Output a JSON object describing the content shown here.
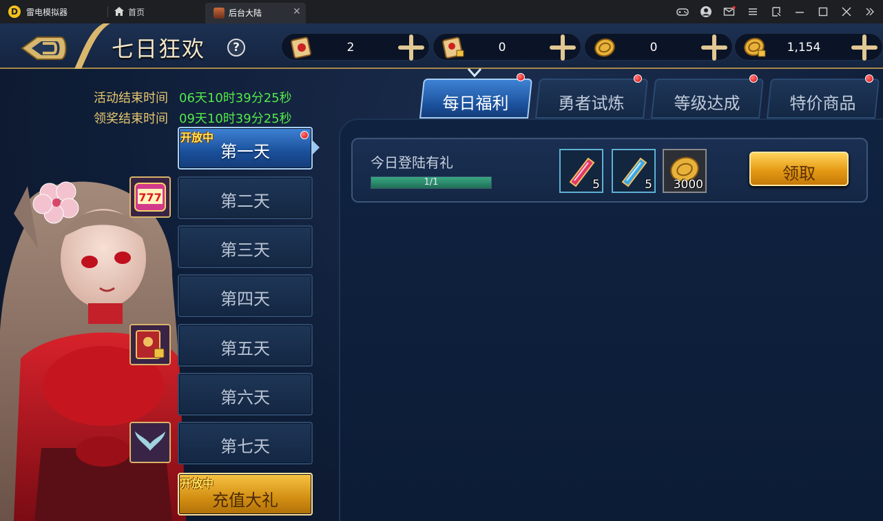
{
  "emulator": {
    "app_name": "雷电模拟器",
    "home_label": "首页",
    "tab_label": "后台大陆",
    "tab_close": "✕",
    "logo_letter": "D"
  },
  "header": {
    "title": "七日狂欢",
    "help": "?",
    "currencies": [
      {
        "icon": "scroll-icon",
        "value": "2"
      },
      {
        "icon": "locked-scroll-icon",
        "value": "0"
      },
      {
        "icon": "gold-coin-icon",
        "value": "0"
      },
      {
        "icon": "locked-coin-icon",
        "value": "1,154"
      }
    ]
  },
  "timers": {
    "activity_label": "活动结束时间",
    "activity_value": "06天10时39分25秒",
    "reward_label": "领奖结束时间",
    "reward_value": "09天10时39分25秒"
  },
  "days": [
    {
      "label": "第一天",
      "state": "active",
      "tag": "开放中"
    },
    {
      "label": "第二天",
      "state": "normal"
    },
    {
      "label": "第三天",
      "state": "normal"
    },
    {
      "label": "第四天",
      "state": "normal"
    },
    {
      "label": "第五天",
      "state": "normal"
    },
    {
      "label": "第六天",
      "state": "normal"
    },
    {
      "label": "第七天",
      "state": "normal"
    },
    {
      "label": "充值大礼",
      "state": "gold",
      "tag": "开放中"
    }
  ],
  "tabs": [
    {
      "label": "每日福利",
      "active": true
    },
    {
      "label": "勇者试炼",
      "active": false
    },
    {
      "label": "等级达成",
      "active": false
    },
    {
      "label": "特价商品",
      "active": false
    }
  ],
  "task": {
    "title": "今日登陆有礼",
    "progress_text": "1/1",
    "progress": 1.0,
    "rewards": [
      {
        "icon": "red-crystal-icon",
        "count": "5"
      },
      {
        "icon": "blue-crystal-icon",
        "count": "5"
      },
      {
        "icon": "gold-coin-icon",
        "count": "3000"
      }
    ],
    "claim_label": "领取"
  },
  "colors": {
    "timer_label": "#e6c770",
    "timer_value": "#54e84a",
    "accent_gold": "#a9894b",
    "active_blue": "#3e82d4"
  }
}
